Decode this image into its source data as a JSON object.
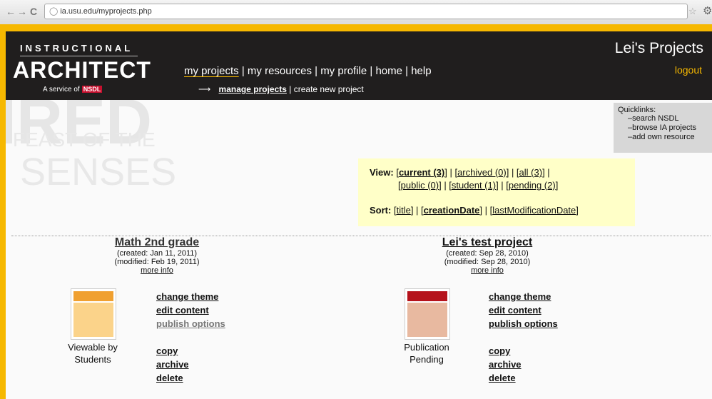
{
  "browser": {
    "back": "←",
    "forward": "→",
    "reload": "C",
    "url": "ia.usu.edu/myprojects.php"
  },
  "header": {
    "logo_top": "INSTRUCTIONAL",
    "logo_main": "ARCHITECT",
    "logo_sub": "A service of",
    "logo_brand": "NSDL",
    "title": "Lei's Projects",
    "logout": "logout",
    "nav": [
      "my projects",
      "my resources",
      "my profile",
      "home",
      "help"
    ],
    "subnav_arrow": "⟶",
    "subnav": [
      "manage projects",
      "create new project"
    ]
  },
  "quicklinks": {
    "title": "Quicklinks:",
    "items": [
      "search NSDL",
      "browse IA projects",
      "add own resource"
    ]
  },
  "view": {
    "label": "View:",
    "row1": [
      "current (3)",
      "archived (0)",
      "all (3)"
    ],
    "row2": [
      "public (0)",
      "student (1)",
      "pending (2)"
    ],
    "sort_label": "Sort:",
    "sort": [
      "title",
      "creationDate",
      "lastModificationDate"
    ]
  },
  "background": {
    "word1": "IRED",
    "word2": "FEAST OF THE",
    "word3": "SENSES"
  },
  "projects": [
    {
      "title": "Math 2nd grade",
      "created": "(created: Jan 11, 2011)",
      "modified": "(modified: Feb 19, 2011)",
      "more": "more info",
      "status": "Viewable by Students",
      "bar_color": "#f0a030",
      "body_color": "#fbd38a",
      "actions": [
        "change theme",
        "edit content",
        "publish options",
        "copy",
        "archive",
        "delete"
      ]
    },
    {
      "title": "Lei's test project",
      "created": "(created: Sep 28, 2010)",
      "modified": "(modified: Sep 28, 2010)",
      "more": "more info",
      "status": "Publication Pending",
      "bar_color": "#b5121b",
      "body_color": "#e8b9a0",
      "actions": [
        "change theme",
        "edit content",
        "publish options",
        "copy",
        "archive",
        "delete"
      ]
    }
  ]
}
